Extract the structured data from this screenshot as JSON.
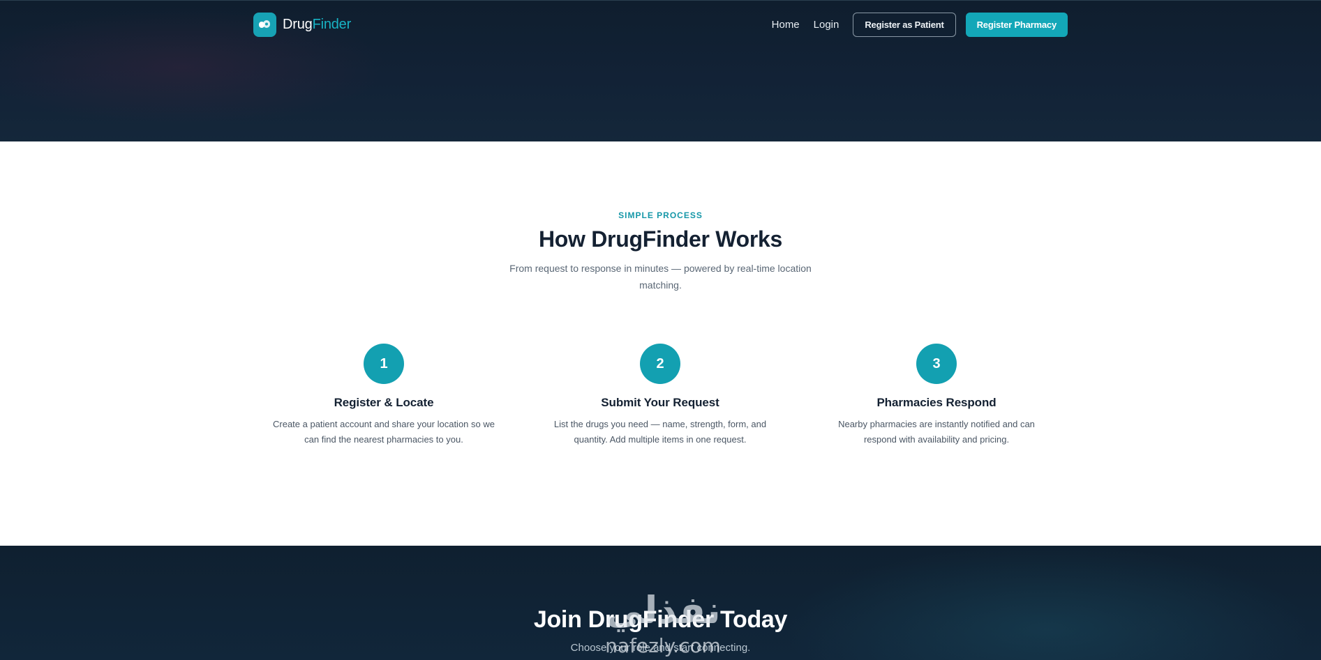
{
  "nav": {
    "brand_part1": "Drug",
    "brand_part2": "Finder",
    "home": "Home",
    "login": "Login",
    "register_patient": "Register as Patient",
    "register_pharmacy": "Register Pharmacy"
  },
  "how": {
    "eyebrow": "SIMPLE PROCESS",
    "title": "How DrugFinder Works",
    "subtitle": "From request to response in minutes — powered by real-time location matching.",
    "steps": [
      {
        "number": "1",
        "title": "Register & Locate",
        "description": "Create a patient account and share your location so we can find the nearest pharmacies to you."
      },
      {
        "number": "2",
        "title": "Submit Your Request",
        "description": "List the drugs you need — name, strength, form, and quantity. Add multiple items in one request."
      },
      {
        "number": "3",
        "title": "Pharmacies Respond",
        "description": "Nearby pharmacies are instantly notified and can respond with availability and pricing."
      }
    ]
  },
  "join": {
    "title": "Join DrugFinder Today",
    "subtitle": "Choose your role and start connecting."
  },
  "watermark": {
    "arabic": "نفذلي",
    "latin": "nafezly.com"
  },
  "colors": {
    "accent": "#13a7b8",
    "dark_bg": "#122236",
    "heading": "#142132"
  },
  "icons": {
    "brand_mark": "pill-capsule-icon"
  }
}
